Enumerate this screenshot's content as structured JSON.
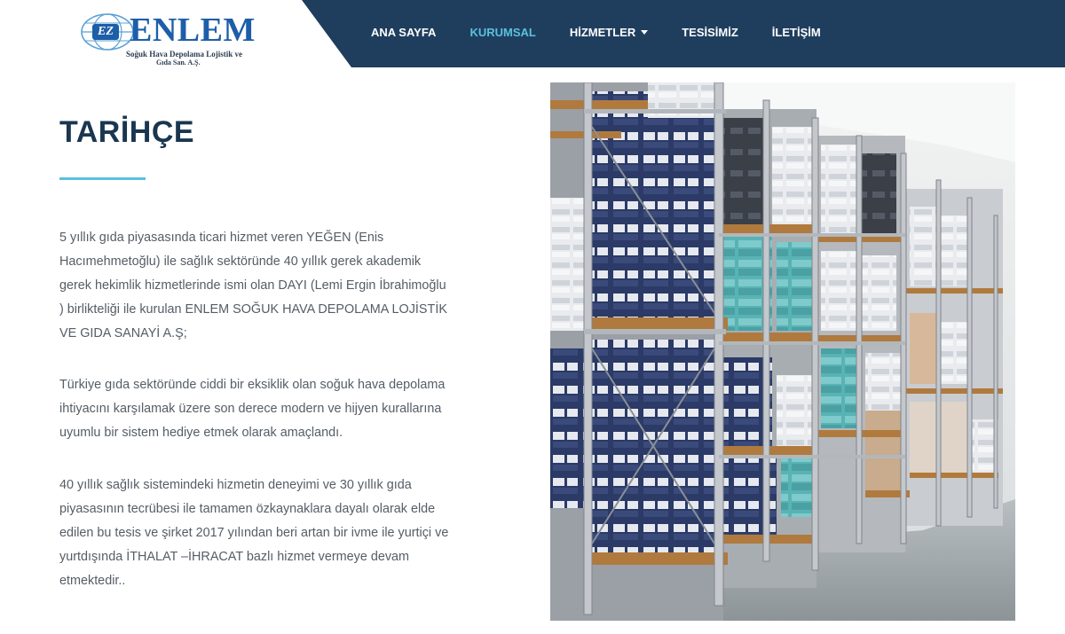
{
  "logo": {
    "name": "ENLEM",
    "badge": "EZ",
    "subtitle_line1": "Soğuk Hava Depolama Lojistik ve",
    "subtitle_line2": "Gıda San. A.Ş."
  },
  "nav": {
    "items": [
      {
        "label": "ANA SAYFA",
        "active": false
      },
      {
        "label": "KURUMSAL",
        "active": true
      },
      {
        "label": "HİZMETLER",
        "active": false,
        "has_dropdown": true
      },
      {
        "label": "TESİSİMİZ",
        "active": false
      },
      {
        "label": "İLETİŞİM",
        "active": false
      }
    ]
  },
  "main": {
    "title": "TARİHÇE",
    "paragraphs": [
      "5 yıllık gıda piyasasında ticari hizmet veren YEĞEN (Enis Hacımehmetoğlu) ile sağlık sektöründe 40 yıllık gerek akademik gerek hekimlik hizmetlerinde ismi olan DAYI (Lemi Ergin İbrahimoğlu ) birlikteliği ile kurulan ENLEM SOĞUK HAVA DEPOLAMA LOJİSTİK VE GIDA SANAYİ A.Ş;",
      "Türkiye gıda sektöründe ciddi bir eksiklik olan soğuk hava depolama ihtiyacını karşılamak üzere son derece modern ve hijyen kurallarına uyumlu bir sistem hediye etmek olarak amaçlandı.",
      "40 yıllık sağlık sistemindeki hizmetin deneyimi ve 30 yıllık gıda piyasasının tecrübesi ile tamamen özkaynaklara dayalı olarak elde edilen bu tesis ve şirket 2017 yılından beri artan bir ivme ile yurtiçi ve yurtdışında İTHALAT –İHRACAT bazlı hizmet vermeye devam etmektedir.."
    ]
  },
  "colors": {
    "nav_bg": "#1f3e5e",
    "accent": "#5bc0de",
    "title": "#1a3650",
    "logo_blue": "#1d5ea8"
  },
  "icons": {
    "dropdown": "caret-down-icon",
    "photo": "cold-storage-warehouse-photo"
  }
}
